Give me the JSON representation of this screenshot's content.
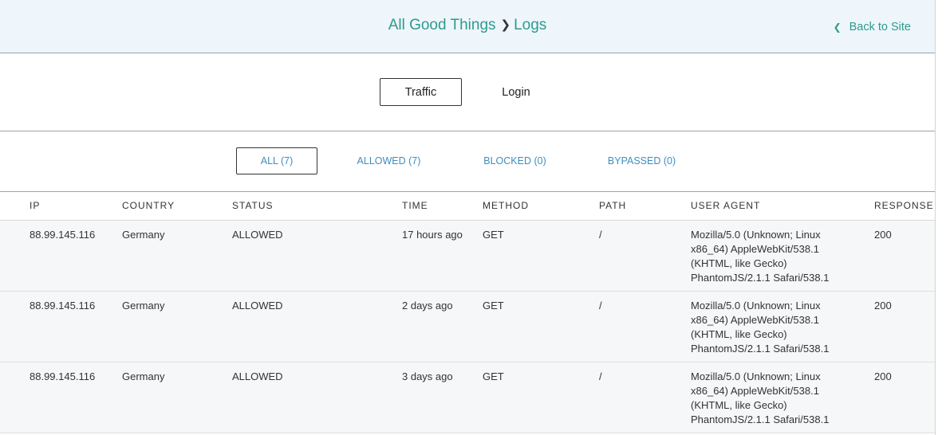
{
  "header": {
    "site_name": "All Good Things",
    "section": "Logs",
    "back_label": "Back to Site"
  },
  "log_tabs": [
    {
      "label": "Traffic",
      "active": true
    },
    {
      "label": "Login",
      "active": false
    }
  ],
  "filters": [
    {
      "label": "ALL (7)",
      "active": true
    },
    {
      "label": "ALLOWED (7)",
      "active": false
    },
    {
      "label": "BLOCKED (0)",
      "active": false
    },
    {
      "label": "BYPASSED (0)",
      "active": false
    }
  ],
  "table": {
    "columns": [
      "IP",
      "COUNTRY",
      "STATUS",
      "TIME",
      "METHOD",
      "PATH",
      "USER AGENT",
      "RESPONSE"
    ],
    "rows": [
      {
        "ip": "88.99.145.116",
        "country": "Germany",
        "status": "ALLOWED",
        "time": "17 hours ago",
        "method": "GET",
        "path": "/",
        "user_agent": "Mozilla/5.0 (Unknown; Linux x86_64) AppleWebKit/538.1 (KHTML, like Gecko) PhantomJS/2.1.1 Safari/538.1",
        "response": "200"
      },
      {
        "ip": "88.99.145.116",
        "country": "Germany",
        "status": "ALLOWED",
        "time": "2 days ago",
        "method": "GET",
        "path": "/",
        "user_agent": "Mozilla/5.0 (Unknown; Linux x86_64) AppleWebKit/538.1 (KHTML, like Gecko) PhantomJS/2.1.1 Safari/538.1",
        "response": "200"
      },
      {
        "ip": "88.99.145.116",
        "country": "Germany",
        "status": "ALLOWED",
        "time": "3 days ago",
        "method": "GET",
        "path": "/",
        "user_agent": "Mozilla/5.0 (Unknown; Linux x86_64) AppleWebKit/538.1 (KHTML, like Gecko) PhantomJS/2.1.1 Safari/538.1",
        "response": "200"
      }
    ]
  },
  "colors": {
    "accent_teal": "#2e9a8e",
    "link_blue": "#3f8dbf",
    "header_bg": "#eef6fb",
    "row_bg": "#f6f7f8"
  },
  "icons": {
    "breadcrumb_separator": "chevron-right-icon",
    "back": "chevron-left-icon"
  }
}
